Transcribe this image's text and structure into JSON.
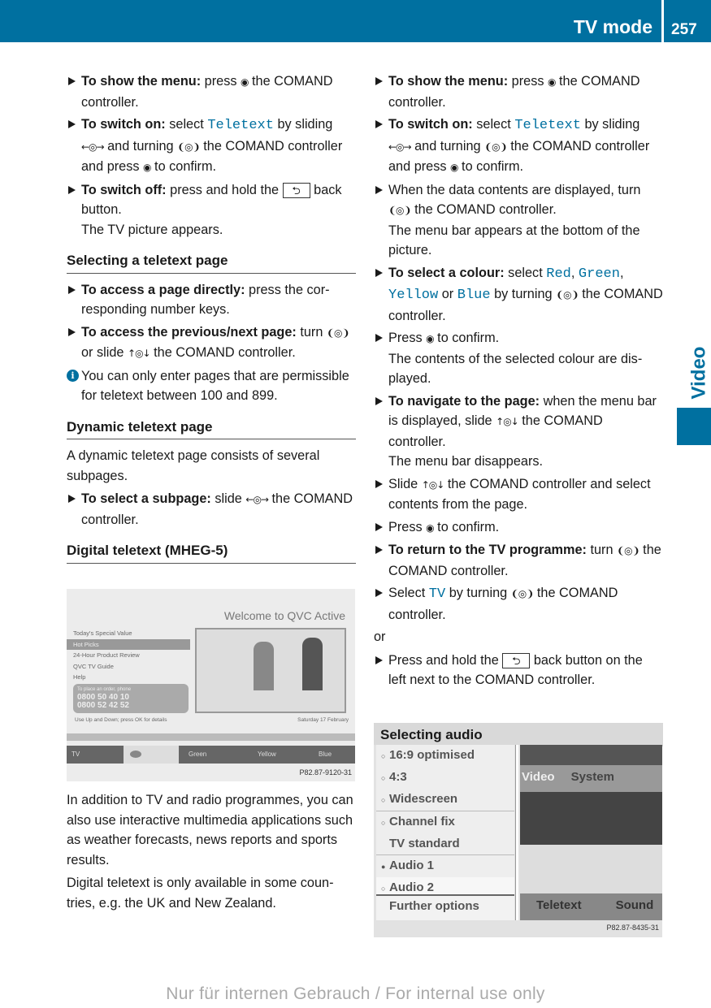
{
  "header": {
    "title": "TV mode",
    "page": "257"
  },
  "side_tab": {
    "label": "Video"
  },
  "colors": {
    "accent": "#0070a0"
  },
  "icons": {
    "press": "◉",
    "slide_lr": "←◎→",
    "turn": "❨◎❩",
    "slide_ud": "↑◎↓",
    "back": "⮌"
  },
  "left": [
    {
      "type": "step",
      "parts": [
        [
          "b",
          "To show the menu:"
        ],
        [
          "t",
          " press "
        ],
        [
          "i",
          "press"
        ],
        [
          "t",
          " the COMAND controller."
        ]
      ]
    },
    {
      "type": "step",
      "parts": [
        [
          "b",
          "To switch on:"
        ],
        [
          "t",
          " select "
        ],
        [
          "m",
          "Teletext"
        ],
        [
          "t",
          " by sliding "
        ],
        [
          "i",
          "slide_lr"
        ],
        [
          "t",
          " and turning "
        ],
        [
          "i",
          "turn"
        ],
        [
          "t",
          " the COMAND con­troller and press "
        ],
        [
          "i",
          "press"
        ],
        [
          "t",
          " to confirm."
        ]
      ]
    },
    {
      "type": "step",
      "parts": [
        [
          "b",
          "To switch off:"
        ],
        [
          "t",
          " press and hold the "
        ],
        [
          "k",
          "back"
        ],
        [
          "t",
          " back button."
        ]
      ],
      "result": "The TV picture appears."
    },
    {
      "type": "heading",
      "text": "Selecting a teletext page"
    },
    {
      "type": "step",
      "parts": [
        [
          "b",
          "To access a page directly:"
        ],
        [
          "t",
          " press the cor­responding number keys."
        ]
      ]
    },
    {
      "type": "step",
      "parts": [
        [
          "b",
          "To access the previous/next page:"
        ],
        [
          "t",
          " turn "
        ],
        [
          "i",
          "turn"
        ],
        [
          "t",
          " or slide "
        ],
        [
          "i",
          "slide_ud"
        ],
        [
          "t",
          " the COMAND controller."
        ]
      ]
    },
    {
      "type": "info",
      "parts": [
        [
          "t",
          "You can only enter pages that are permis­sible for teletext between 100 and 899."
        ]
      ]
    },
    {
      "type": "heading",
      "text": "Dynamic teletext page"
    },
    {
      "type": "para",
      "parts": [
        [
          "t",
          "A dynamic teletext page consists of several subpages."
        ]
      ]
    },
    {
      "type": "step",
      "parts": [
        [
          "b",
          "To select a subpage:"
        ],
        [
          "t",
          " slide "
        ],
        [
          "i",
          "slide_lr"
        ],
        [
          "t",
          " the COMAND controller."
        ]
      ]
    },
    {
      "type": "heading",
      "text": "Digital teletext (MHEG-5)"
    }
  ],
  "left_bottom": [
    "In addition to TV and radio programmes, you can also use interactive multimedia applica­tions such as weather forecasts, news reports and sports results.",
    "Digital teletext is only available in some coun­tries, e.g. the UK and New Zealand."
  ],
  "right": [
    {
      "type": "step",
      "parts": [
        [
          "b",
          "To show the menu:"
        ],
        [
          "t",
          " press "
        ],
        [
          "i",
          "press"
        ],
        [
          "t",
          " the COMAND controller."
        ]
      ]
    },
    {
      "type": "step",
      "parts": [
        [
          "b",
          "To switch on:"
        ],
        [
          "t",
          " select "
        ],
        [
          "m",
          "Teletext"
        ],
        [
          "t",
          " by sliding "
        ],
        [
          "i",
          "slide_lr"
        ],
        [
          "t",
          " and turning "
        ],
        [
          "i",
          "turn"
        ],
        [
          "t",
          " the COMAND con­troller and press "
        ],
        [
          "i",
          "press"
        ],
        [
          "t",
          " to confirm."
        ]
      ]
    },
    {
      "type": "step",
      "parts": [
        [
          "t",
          "When the data contents are displayed, turn "
        ],
        [
          "i",
          "turn"
        ],
        [
          "t",
          " the COMAND controller."
        ]
      ],
      "result": "The menu bar appears at the bottom of the picture."
    },
    {
      "type": "step",
      "parts": [
        [
          "b",
          "To select a colour:"
        ],
        [
          "t",
          " select "
        ],
        [
          "m",
          "Red"
        ],
        [
          "t",
          ", "
        ],
        [
          "m",
          "Green"
        ],
        [
          "t",
          ", "
        ],
        [
          "m",
          "Yellow"
        ],
        [
          "t",
          " or "
        ],
        [
          "m",
          "Blue"
        ],
        [
          "t",
          " by turning "
        ],
        [
          "i",
          "turn"
        ],
        [
          "t",
          " the COMAND controller."
        ]
      ]
    },
    {
      "type": "step",
      "parts": [
        [
          "t",
          "Press "
        ],
        [
          "i",
          "press"
        ],
        [
          "t",
          " to confirm."
        ]
      ],
      "result": "The contents of the selected colour are dis­played."
    },
    {
      "type": "step",
      "parts": [
        [
          "b",
          "To navigate to the page:"
        ],
        [
          "t",
          " when the menu bar is displayed, slide "
        ],
        [
          "i",
          "slide_ud"
        ],
        [
          "t",
          " the COMAND controller."
        ]
      ],
      "result": "The menu bar disappears."
    },
    {
      "type": "step",
      "parts": [
        [
          "t",
          "Slide "
        ],
        [
          "i",
          "slide_ud"
        ],
        [
          "t",
          " the COMAND controller and select contents from the page."
        ]
      ]
    },
    {
      "type": "step",
      "parts": [
        [
          "t",
          "Press "
        ],
        [
          "i",
          "press"
        ],
        [
          "t",
          " to confirm."
        ]
      ]
    },
    {
      "type": "step",
      "parts": [
        [
          "b",
          "To return to the TV programme:"
        ],
        [
          "t",
          " turn "
        ],
        [
          "i",
          "turn"
        ],
        [
          "t",
          " the COMAND controller."
        ]
      ]
    },
    {
      "type": "step",
      "parts": [
        [
          "t",
          "Select "
        ],
        [
          "m",
          "TV"
        ],
        [
          "t",
          " by turning "
        ],
        [
          "i",
          "turn"
        ],
        [
          "t",
          " the COMAND controller."
        ]
      ]
    },
    {
      "type": "or",
      "text": "or"
    },
    {
      "type": "step",
      "parts": [
        [
          "t",
          "Press and hold the "
        ],
        [
          "k",
          "back"
        ],
        [
          "t",
          " back button on the left next to the COMAND controller."
        ]
      ]
    },
    {
      "type": "hbox",
      "text": "Selecting audio"
    }
  ],
  "image1": {
    "banner": "Welcome to QVC Active",
    "menu": [
      "Today's Special Value",
      "Hot Picks",
      "24-Hour Product Review",
      "QVC TV Guide",
      "Help"
    ],
    "phone_label": "To place an order, phone",
    "phone1": "0800 50 40 10",
    "phone2": "0800 52 42 52",
    "hint": "Use Up and Down; press OK for details",
    "date": "Saturday 17 February",
    "bar": [
      "TV",
      "Green",
      "Yellow",
      "Blue"
    ],
    "code": "P82.87-9120-31"
  },
  "image2": {
    "options": [
      {
        "label": "16:9 optimised",
        "mark": "○"
      },
      {
        "label": "4:3",
        "mark": "○"
      },
      {
        "label": "Widescreen",
        "mark": "○"
      },
      {
        "label": "Channel fix",
        "mark": "○"
      },
      {
        "label": "TV standard",
        "mark": ""
      },
      {
        "label": "Audio 1",
        "mark": "●"
      },
      {
        "label": "Audio 2",
        "mark": "○"
      }
    ],
    "further": "Further options",
    "top_menu": [
      "Video",
      "System"
    ],
    "bottom_menu": [
      "Teletext",
      "Sound"
    ],
    "code": "P82.87-8435-31"
  },
  "footer": "Nur für internen Gebrauch / For internal use only"
}
